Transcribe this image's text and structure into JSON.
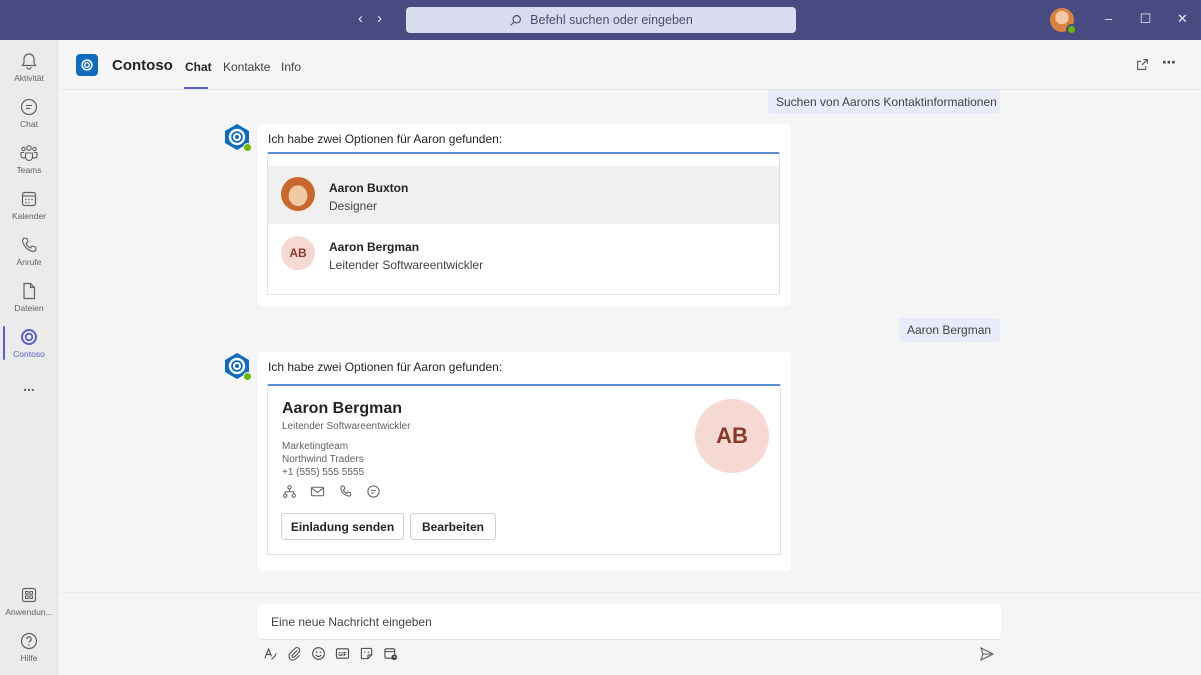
{
  "titlebar": {
    "search_placeholder": "Befehl suchen oder eingeben",
    "back_icon": "chevron-left-icon",
    "forward_icon": "chevron-right-icon"
  },
  "rail": {
    "items": [
      {
        "label": "Aktivität",
        "icon": "bell-icon"
      },
      {
        "label": "Chat",
        "icon": "chat-icon"
      },
      {
        "label": "Teams",
        "icon": "teams-icon"
      },
      {
        "label": "Kalender",
        "icon": "calendar-icon"
      },
      {
        "label": "Anrufe",
        "icon": "phone-icon"
      },
      {
        "label": "Dateien",
        "icon": "file-icon"
      },
      {
        "label": "Contoso",
        "icon": "contoso-icon"
      }
    ],
    "more": "...",
    "bottom": [
      {
        "label": "Anwendun...",
        "icon": "apps-icon"
      },
      {
        "label": "Hilfe",
        "icon": "help-icon"
      }
    ]
  },
  "header": {
    "app_name": "Contoso",
    "tabs": [
      "Chat",
      "Kontakte",
      "Info"
    ],
    "active_tab": "Chat"
  },
  "conversation": {
    "sent_1": "Suchen von Aarons Kontaktinformationen",
    "bot_1": {
      "text": "Ich habe zwei Optionen für Aaron gefunden:",
      "options": [
        {
          "name": "Aaron Buxton",
          "role": "Designer",
          "avatar": "photo"
        },
        {
          "name": "Aaron Bergman",
          "role": "Leitender Softwareentwickler",
          "initials": "AB"
        }
      ]
    },
    "sent_2": "Aaron Bergman",
    "bot_2": {
      "text": "Ich habe zwei Optionen für Aaron gefunden:",
      "card": {
        "name": "Aaron Bergman",
        "role": "Leitender Softwareentwickler",
        "team": "Marketingteam",
        "company": "Northwind Traders",
        "phone": "+1 (555) 555 5555",
        "initials": "AB",
        "actions": [
          "org-chart-icon",
          "mail-icon",
          "phone-icon",
          "chat-icon"
        ],
        "buttons": [
          "Einladung senden",
          "Bearbeiten"
        ]
      }
    }
  },
  "compose": {
    "placeholder": "Eine neue Nachricht eingeben",
    "tools": [
      "format-icon",
      "attach-icon",
      "emoji-icon",
      "gif-icon",
      "sticker-icon",
      "schedule-meeting-icon"
    ],
    "send_icon": "send-icon"
  },
  "colors": {
    "titlebar": "#474b82",
    "accent": "#5b5fc7",
    "presence": "#6bb700",
    "initials_bg": "#f7d9d3"
  }
}
